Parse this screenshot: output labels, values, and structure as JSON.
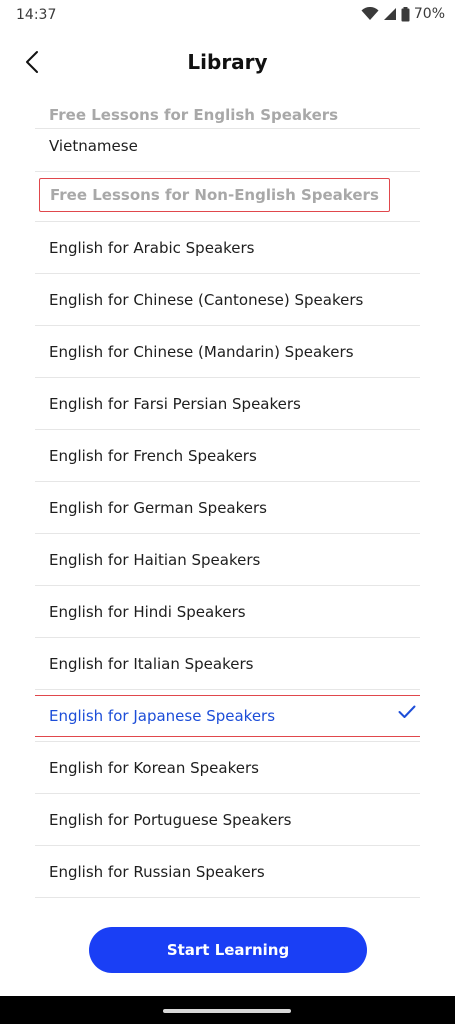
{
  "status_bar": {
    "time": "14:37",
    "battery": "70%",
    "icons": [
      "wifi-icon",
      "signal-icon",
      "battery-icon"
    ]
  },
  "header": {
    "title": "Library",
    "back_icon": "chevron-left-icon"
  },
  "library": {
    "english_speakers_header": "Free Lessons for English Speakers",
    "partial_item": "Vietnamese",
    "non_english_header": "Free Lessons for Non-English Speakers",
    "items": [
      {
        "label": "English for Arabic Speakers",
        "selected": false
      },
      {
        "label": "English for Chinese (Cantonese) Speakers",
        "selected": false
      },
      {
        "label": "English for Chinese (Mandarin) Speakers",
        "selected": false
      },
      {
        "label": "English for Farsi Persian Speakers",
        "selected": false
      },
      {
        "label": "English for French Speakers",
        "selected": false
      },
      {
        "label": "English for German Speakers",
        "selected": false
      },
      {
        "label": "English for Haitian Speakers",
        "selected": false
      },
      {
        "label": "English for Hindi Speakers",
        "selected": false
      },
      {
        "label": "English for Italian Speakers",
        "selected": false
      },
      {
        "label": "English for Japanese Speakers",
        "selected": true
      },
      {
        "label": "English for Korean Speakers",
        "selected": false
      },
      {
        "label": "English for Portuguese Speakers",
        "selected": false
      },
      {
        "label": "English for Russian Speakers",
        "selected": false
      }
    ]
  },
  "cta": {
    "label": "Start Learning"
  },
  "colors": {
    "accent": "#1a3ff5",
    "selected_text": "#1d4ed8",
    "section_header": "#a8a8a8",
    "highlight_border": "#e0474c"
  }
}
